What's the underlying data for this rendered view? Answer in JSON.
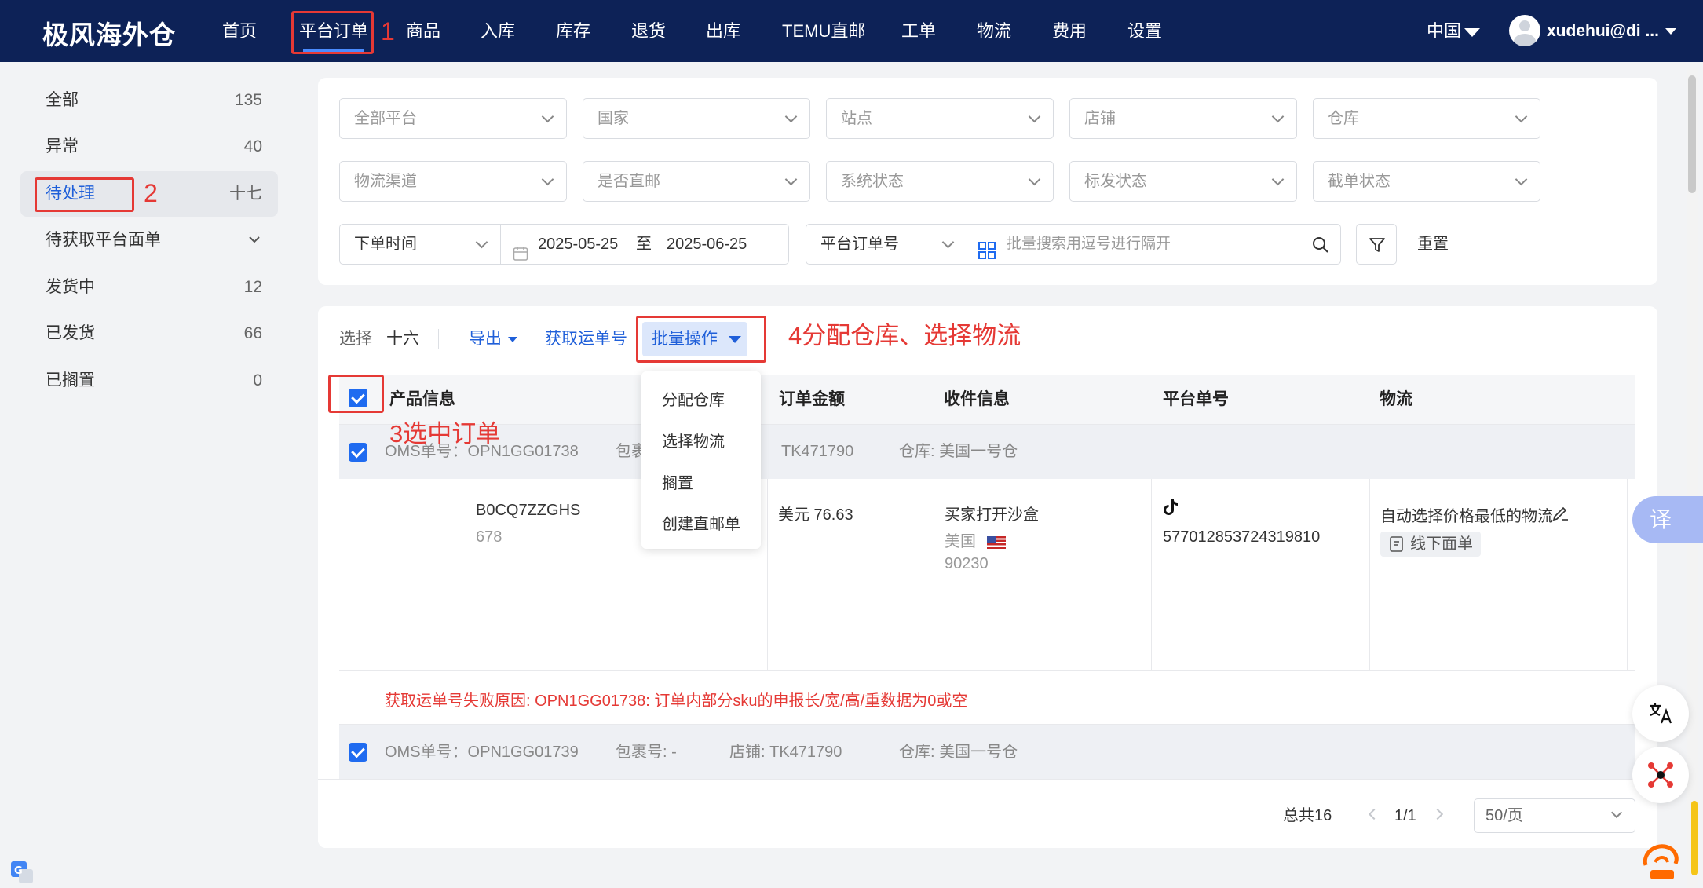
{
  "header": {
    "brand": "极风海外仓",
    "nav": [
      {
        "label": "首页"
      },
      {
        "label": "平台订单"
      },
      {
        "label": "商品"
      },
      {
        "label": "入库"
      },
      {
        "label": "库存"
      },
      {
        "label": "退货"
      },
      {
        "label": "出库"
      },
      {
        "label": "TEMU直邮"
      },
      {
        "label": "工单"
      },
      {
        "label": "物流"
      },
      {
        "label": "费用"
      },
      {
        "label": "设置"
      }
    ],
    "annotation_1": "1",
    "region": "中国",
    "user": "xudehui@di ..."
  },
  "sidebar": {
    "items": [
      {
        "label": "全部",
        "count": "135"
      },
      {
        "label": "异常",
        "count": "40"
      },
      {
        "label": "待处理",
        "count": "十七"
      },
      {
        "label": "待获取平台面单",
        "count": ""
      },
      {
        "label": "发货中",
        "count": "12"
      },
      {
        "label": "已发货",
        "count": "66"
      },
      {
        "label": "已搁置",
        "count": "0"
      }
    ],
    "annotation_2": "2"
  },
  "filters": {
    "row1": [
      "全部平台",
      "国家",
      "站点",
      "店铺",
      "仓库"
    ],
    "row2": [
      "物流渠道",
      "是否直邮",
      "系统状态",
      "标发状态",
      "截单状态"
    ],
    "time_type": "下单时间",
    "date_from": "2025-05-25",
    "date_sep": "至",
    "date_to": "2025-06-25",
    "search_field": "平台订单号",
    "search_placeholder": "批量搜索用逗号进行隔开",
    "reset": "重置"
  },
  "toolbar": {
    "select_label": "选择",
    "select_count": "十六",
    "export": "导出",
    "get_waybill": "获取运单号",
    "batch": "批量操作",
    "annotation_4": "4分配仓库、选择物流"
  },
  "dropdown": {
    "items": [
      "分配仓库",
      "选择物流",
      "搁置",
      "创建直邮单"
    ]
  },
  "table": {
    "headers": {
      "product": "产品信息",
      "amount": "订单金额",
      "receiver": "收件信息",
      "platform_no": "平台单号",
      "logistics": "物流"
    },
    "annotation_3": "3选中订单",
    "orders": [
      {
        "oms": "OMS单号：OPN1GG01738",
        "pkg_label": "包裹",
        "shop": "TK471790",
        "warehouse": "仓库:  美国一号仓",
        "sku": "B0CQ7ZZGHS",
        "qty": "678",
        "amount": "美元 76.63",
        "receiver_name": "买家打开沙盒",
        "country": "美国",
        "zip": "90230",
        "platform_no": "577012853724319810",
        "logistics": "自动选择价格最低的物流",
        "tag": "线下面单",
        "error": "获取运单号失败原因: OPN1GG01738: 订单内部分sku的申报长/宽/高/重数据为0或空"
      },
      {
        "oms": "OMS单号：OPN1GG01739",
        "pkg": "包裹号:  -",
        "shop": "店铺:  TK471790",
        "warehouse": "仓库:  美国一号仓"
      }
    ]
  },
  "pagination": {
    "total": "总共16",
    "page": "1/1",
    "per_page": "50/页"
  },
  "floating": {
    "translate": "译"
  }
}
